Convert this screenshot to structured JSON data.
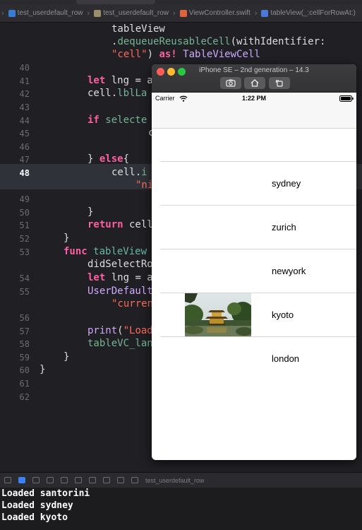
{
  "breadcrumbs": [
    "test_userdefault_row",
    "test_userdefault_row",
    "ViewController.swift",
    "tableView(_:cellForRowAt:)"
  ],
  "active_tab": "ViewController.swift",
  "editor": {
    "line_numbers": [
      "40",
      "41",
      "42",
      "43",
      "44",
      "45",
      "46",
      "47",
      "48",
      "49",
      "50",
      "51",
      "52",
      "53",
      "54",
      "55",
      "56",
      "57",
      "58",
      "59",
      "60",
      "61",
      "62"
    ],
    "current_line": "48",
    "fragments": {
      "l1a": "tableView",
      "l2a": ".",
      "l2b": "dequeueReusableCell",
      "l2c": "(withIdentifier:",
      "l3a": "\"cell\"",
      "l3b": ") ",
      "l3c": "as!",
      "l3d": " ",
      "l3e": "TableViewCell",
      "l41a": "let",
      "l41b": " lng = a",
      "l42a": "cell.",
      "l42b": "lblLa",
      "l44a": "if",
      "l44b": " selecte",
      "l45a": "c",
      "l47a": "} ",
      "l47b": "else",
      "l47c": "{",
      "l48a": "cell.",
      "l48b": "i",
      "l48c": "\"ni",
      "l50a": "}",
      "l51a": "return",
      "l51b": " cell",
      "l52a": "}",
      "l53a": "func",
      "l53b": " ",
      "l53c": "tableView",
      "l53d": "didSelectRo",
      "l54a": "let",
      "l54b": " lng = a",
      "l55a": "UserDefault",
      "l55b": "\"curren",
      "l57a": "print",
      "l57b": "(",
      "l57c": "\"Load",
      "l58a": "tableVC_lan",
      "l59a": "}",
      "l60a": "}"
    }
  },
  "simulator": {
    "title": "iPhone SE – 2nd generation – 14.3",
    "carrier": "Carrier",
    "time": "1:22 PM",
    "rows": [
      {
        "label": "",
        "has_image": false
      },
      {
        "label": "sydney",
        "has_image": false
      },
      {
        "label": "zurich",
        "has_image": false
      },
      {
        "label": "newyork",
        "has_image": false
      },
      {
        "label": "kyoto",
        "has_image": true
      },
      {
        "label": "london",
        "has_image": false
      }
    ]
  },
  "debug_bar": {
    "target": "test_userdefault_row"
  },
  "console": {
    "lines": [
      "Loaded santorini",
      "Loaded sydney",
      "Loaded kyoto"
    ]
  }
}
